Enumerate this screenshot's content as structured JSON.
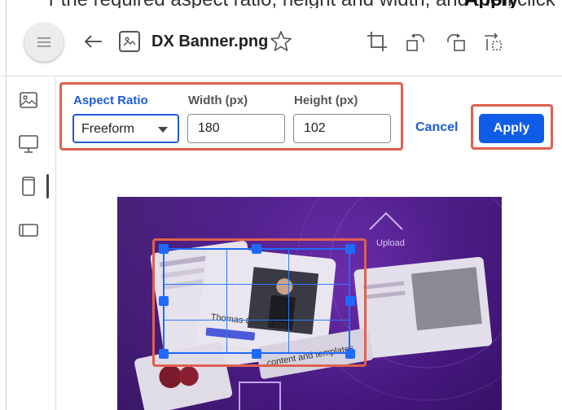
{
  "header": {
    "file_name": "DX Banner.png",
    "top_partial_left": "r the required aspect ratio, height and width, and then click",
    "top_partial_right": "Apply"
  },
  "crop_panel": {
    "aspect_ratio_label": "Aspect Ratio",
    "aspect_ratio_value": "Freeform",
    "width_label": "Width (px)",
    "width_value": "180",
    "height_label": "Height (px)",
    "height_value": "102",
    "cancel_label": "Cancel",
    "apply_label": "Apply"
  },
  "colors": {
    "accent": "#1f5bd8",
    "apply_button": "#0f5ce6",
    "highlight": "#e0604f",
    "crop_frame": "#1f6bff"
  },
  "icons": [
    "menu-icon",
    "back-arrow-icon",
    "image-file-icon",
    "star-icon",
    "crop-icon",
    "rotate-left-icon",
    "rotate-right-icon",
    "flip-icon",
    "image-icon",
    "desktop-icon",
    "mobile-icon",
    "tablet-icon"
  ]
}
